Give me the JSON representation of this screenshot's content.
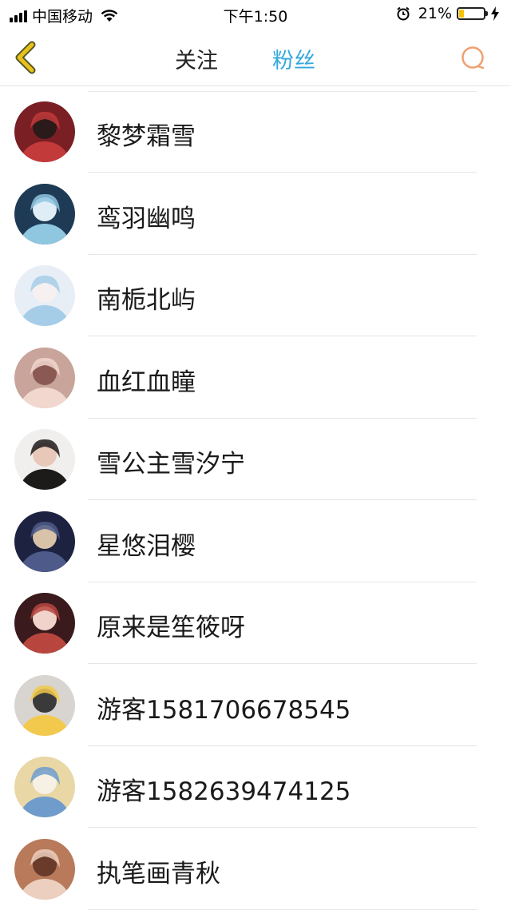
{
  "status_bar": {
    "carrier": "中国移动",
    "time": "下午1:50",
    "battery_percent": "21%",
    "battery_level": 0.21
  },
  "navbar": {
    "back_icon": "chevron-left-icon",
    "tab_follow": "关注",
    "tab_fans": "粉丝",
    "active_tab": "粉丝",
    "search_icon": "search-icon",
    "accent_color": "#33a8dc",
    "back_color": "#e8c21a",
    "search_color": "#f0a070"
  },
  "fans": [
    {
      "name": "黎梦霜雪"
    },
    {
      "name": "鸾羽幽鸣"
    },
    {
      "name": "南栀北屿"
    },
    {
      "name": "血红血瞳"
    },
    {
      "name": "雪公主雪汐宁"
    },
    {
      "name": "星悠泪樱"
    },
    {
      "name": "原来是笙筱呀"
    },
    {
      "name": "游客1581706678545"
    },
    {
      "name": "游客1582639474125"
    },
    {
      "name": "执笔画青秋"
    }
  ]
}
